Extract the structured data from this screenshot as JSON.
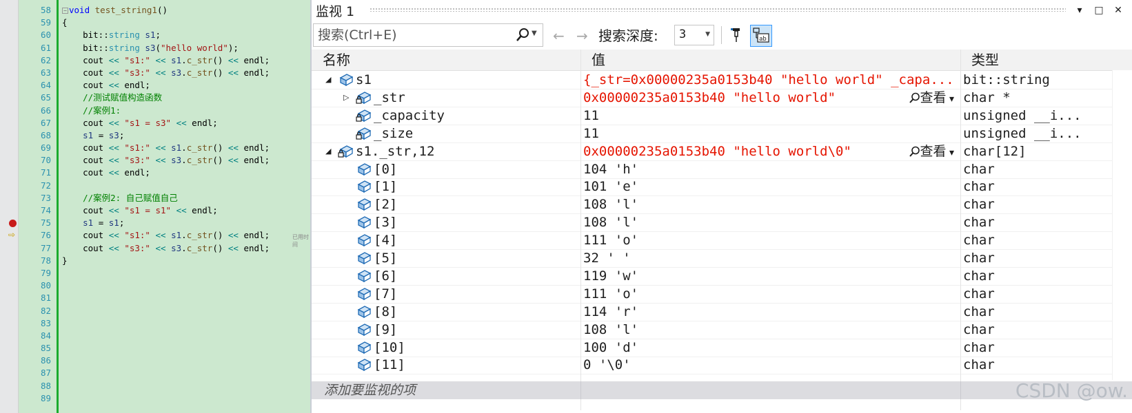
{
  "editor": {
    "line_numbers": [
      "58",
      "59",
      "60",
      "61",
      "62",
      "63",
      "64",
      "65",
      "66",
      "67",
      "68",
      "69",
      "70",
      "71",
      "72",
      "73",
      "74",
      "75",
      "76",
      "77",
      "78",
      "79",
      "80",
      "81",
      "82",
      "83",
      "84",
      "85",
      "86",
      "87",
      "88",
      "89"
    ],
    "lines": [
      [
        {
          "t": "void",
          "c": "kw"
        },
        {
          "t": " "
        },
        {
          "t": "test_string1",
          "c": "fn"
        },
        {
          "t": "()"
        }
      ],
      [
        {
          "t": "{"
        }
      ],
      [
        {
          "t": "    bit::"
        },
        {
          "t": "string",
          "c": "ty"
        },
        {
          "t": " "
        },
        {
          "t": "s1",
          "c": "vr"
        },
        {
          "t": ";"
        }
      ],
      [
        {
          "t": "    bit::"
        },
        {
          "t": "string",
          "c": "ty"
        },
        {
          "t": " "
        },
        {
          "t": "s3",
          "c": "vr"
        },
        {
          "t": "("
        },
        {
          "t": "\"hello world\"",
          "c": "st"
        },
        {
          "t": ");"
        }
      ],
      [
        {
          "t": "    cout "
        },
        {
          "t": "<<",
          "c": "op"
        },
        {
          "t": " "
        },
        {
          "t": "\"s1:\"",
          "c": "st"
        },
        {
          "t": " "
        },
        {
          "t": "<<",
          "c": "op"
        },
        {
          "t": " "
        },
        {
          "t": "s1",
          "c": "vr"
        },
        {
          "t": "."
        },
        {
          "t": "c_str",
          "c": "fn"
        },
        {
          "t": "() "
        },
        {
          "t": "<<",
          "c": "op"
        },
        {
          "t": " endl;"
        }
      ],
      [
        {
          "t": "    cout "
        },
        {
          "t": "<<",
          "c": "op"
        },
        {
          "t": " "
        },
        {
          "t": "\"s3:\"",
          "c": "st"
        },
        {
          "t": " "
        },
        {
          "t": "<<",
          "c": "op"
        },
        {
          "t": " "
        },
        {
          "t": "s3",
          "c": "vr"
        },
        {
          "t": "."
        },
        {
          "t": "c_str",
          "c": "fn"
        },
        {
          "t": "() "
        },
        {
          "t": "<<",
          "c": "op"
        },
        {
          "t": " endl;"
        }
      ],
      [
        {
          "t": "    cout "
        },
        {
          "t": "<<",
          "c": "op"
        },
        {
          "t": " endl;"
        }
      ],
      [
        {
          "t": "    //测试赋值构造函数",
          "c": "cm"
        }
      ],
      [
        {
          "t": "    //案例1:",
          "c": "cm"
        }
      ],
      [
        {
          "t": "    cout "
        },
        {
          "t": "<<",
          "c": "op"
        },
        {
          "t": " "
        },
        {
          "t": "\"s1 = s3\"",
          "c": "st"
        },
        {
          "t": " "
        },
        {
          "t": "<<",
          "c": "op"
        },
        {
          "t": " endl;"
        }
      ],
      [
        {
          "t": "    "
        },
        {
          "t": "s1",
          "c": "vr"
        },
        {
          "t": " = "
        },
        {
          "t": "s3",
          "c": "vr"
        },
        {
          "t": ";"
        }
      ],
      [
        {
          "t": "    cout "
        },
        {
          "t": "<<",
          "c": "op"
        },
        {
          "t": " "
        },
        {
          "t": "\"s1:\"",
          "c": "st"
        },
        {
          "t": " "
        },
        {
          "t": "<<",
          "c": "op"
        },
        {
          "t": " "
        },
        {
          "t": "s1",
          "c": "vr"
        },
        {
          "t": "."
        },
        {
          "t": "c_str",
          "c": "fn"
        },
        {
          "t": "() "
        },
        {
          "t": "<<",
          "c": "op"
        },
        {
          "t": " endl;"
        }
      ],
      [
        {
          "t": "    cout "
        },
        {
          "t": "<<",
          "c": "op"
        },
        {
          "t": " "
        },
        {
          "t": "\"s3:\"",
          "c": "st"
        },
        {
          "t": " "
        },
        {
          "t": "<<",
          "c": "op"
        },
        {
          "t": " "
        },
        {
          "t": "s3",
          "c": "vr"
        },
        {
          "t": "."
        },
        {
          "t": "c_str",
          "c": "fn"
        },
        {
          "t": "() "
        },
        {
          "t": "<<",
          "c": "op"
        },
        {
          "t": " endl;"
        }
      ],
      [
        {
          "t": "    cout "
        },
        {
          "t": "<<",
          "c": "op"
        },
        {
          "t": " endl;"
        }
      ],
      [],
      [
        {
          "t": "    //案例2: 自己赋值自己",
          "c": "cm"
        }
      ],
      [
        {
          "t": "    cout "
        },
        {
          "t": "<<",
          "c": "op"
        },
        {
          "t": " "
        },
        {
          "t": "\"s1 = s1\"",
          "c": "st"
        },
        {
          "t": " "
        },
        {
          "t": "<<",
          "c": "op"
        },
        {
          "t": " endl;"
        }
      ],
      [
        {
          "t": "    "
        },
        {
          "t": "s1",
          "c": "vr"
        },
        {
          "t": " = "
        },
        {
          "t": "s1",
          "c": "vr"
        },
        {
          "t": ";"
        }
      ],
      [
        {
          "t": "    cout "
        },
        {
          "t": "<<",
          "c": "op"
        },
        {
          "t": " "
        },
        {
          "t": "\"s1:\"",
          "c": "st"
        },
        {
          "t": " "
        },
        {
          "t": "<<",
          "c": "op"
        },
        {
          "t": " "
        },
        {
          "t": "s1",
          "c": "vr"
        },
        {
          "t": "."
        },
        {
          "t": "c_str",
          "c": "fn"
        },
        {
          "t": "() "
        },
        {
          "t": "<<",
          "c": "op"
        },
        {
          "t": " endl;"
        }
      ],
      [
        {
          "t": "    cout "
        },
        {
          "t": "<<",
          "c": "op"
        },
        {
          "t": " "
        },
        {
          "t": "\"s3:\"",
          "c": "st"
        },
        {
          "t": " "
        },
        {
          "t": "<<",
          "c": "op"
        },
        {
          "t": " "
        },
        {
          "t": "s3",
          "c": "vr"
        },
        {
          "t": "."
        },
        {
          "t": "c_str",
          "c": "fn"
        },
        {
          "t": "() "
        },
        {
          "t": "<<",
          "c": "op"
        },
        {
          "t": " endl;"
        }
      ],
      [
        {
          "t": "}"
        }
      ],
      [],
      [],
      [],
      [],
      [],
      [],
      [],
      [],
      [],
      [],
      []
    ],
    "inline_hint": "已用时间",
    "breakpoint_line": "75",
    "current_line": "76"
  },
  "watch": {
    "title": "监视 1",
    "window_buttons": {
      "dropdown": "▾",
      "maximize": "□",
      "close": "✕"
    },
    "search": {
      "placeholder": "搜索(Ctrl+E)",
      "value": ""
    },
    "nav": {
      "back": "←",
      "forward": "→"
    },
    "depth_label": "搜索深度:",
    "depth_value": "3",
    "columns": {
      "name": "名称",
      "value": "值",
      "type": "类型"
    },
    "rows": [
      {
        "name": "s1",
        "value": "{_str=0x00000235a0153b40 \"hello world\" _capa...",
        "type": "bit::string",
        "level": 0,
        "expander": "◢",
        "locked": false,
        "changed": true,
        "view": ""
      },
      {
        "name": "_str",
        "value": "0x00000235a0153b40 \"hello world\"",
        "type": "char *",
        "level": 1,
        "expander": "▷",
        "locked": true,
        "changed": true,
        "view": "查看"
      },
      {
        "name": "_capacity",
        "value": "11",
        "type": "unsigned __i...",
        "level": 1,
        "expander": "",
        "locked": true,
        "changed": false,
        "view": ""
      },
      {
        "name": "_size",
        "value": "11",
        "type": "unsigned __i...",
        "level": 1,
        "expander": "",
        "locked": true,
        "changed": false,
        "view": ""
      },
      {
        "name": "s1._str,12",
        "value": "0x00000235a0153b40 \"hello world\\0\"",
        "type": "char[12]",
        "level": 0,
        "expander": "◢",
        "locked": true,
        "changed": true,
        "view": "查看"
      },
      {
        "name": "[0]",
        "value": "104 'h'",
        "type": "char",
        "level": 1,
        "expander": "",
        "locked": false,
        "changed": false,
        "view": ""
      },
      {
        "name": "[1]",
        "value": "101 'e'",
        "type": "char",
        "level": 1,
        "expander": "",
        "locked": false,
        "changed": false,
        "view": ""
      },
      {
        "name": "[2]",
        "value": "108 'l'",
        "type": "char",
        "level": 1,
        "expander": "",
        "locked": false,
        "changed": false,
        "view": ""
      },
      {
        "name": "[3]",
        "value": "108 'l'",
        "type": "char",
        "level": 1,
        "expander": "",
        "locked": false,
        "changed": false,
        "view": ""
      },
      {
        "name": "[4]",
        "value": "111 'o'",
        "type": "char",
        "level": 1,
        "expander": "",
        "locked": false,
        "changed": false,
        "view": ""
      },
      {
        "name": "[5]",
        "value": "32 ' '",
        "type": "char",
        "level": 1,
        "expander": "",
        "locked": false,
        "changed": false,
        "view": ""
      },
      {
        "name": "[6]",
        "value": "119 'w'",
        "type": "char",
        "level": 1,
        "expander": "",
        "locked": false,
        "changed": false,
        "view": ""
      },
      {
        "name": "[7]",
        "value": "111 'o'",
        "type": "char",
        "level": 1,
        "expander": "",
        "locked": false,
        "changed": false,
        "view": ""
      },
      {
        "name": "[8]",
        "value": "114 'r'",
        "type": "char",
        "level": 1,
        "expander": "",
        "locked": false,
        "changed": false,
        "view": ""
      },
      {
        "name": "[9]",
        "value": "108 'l'",
        "type": "char",
        "level": 1,
        "expander": "",
        "locked": false,
        "changed": false,
        "view": ""
      },
      {
        "name": "[10]",
        "value": "100 'd'",
        "type": "char",
        "level": 1,
        "expander": "",
        "locked": false,
        "changed": false,
        "view": ""
      },
      {
        "name": "[11]",
        "value": "0 '\\0'",
        "type": "char",
        "level": 1,
        "expander": "",
        "locked": false,
        "changed": false,
        "view": ""
      }
    ],
    "add_item_placeholder": "添加要监视的项",
    "colors": {
      "changed_value": "#e51400",
      "editor_bg": "#cce8cf",
      "header_bg": "#f2f2f2"
    }
  },
  "watermark": "CSDN @ow."
}
